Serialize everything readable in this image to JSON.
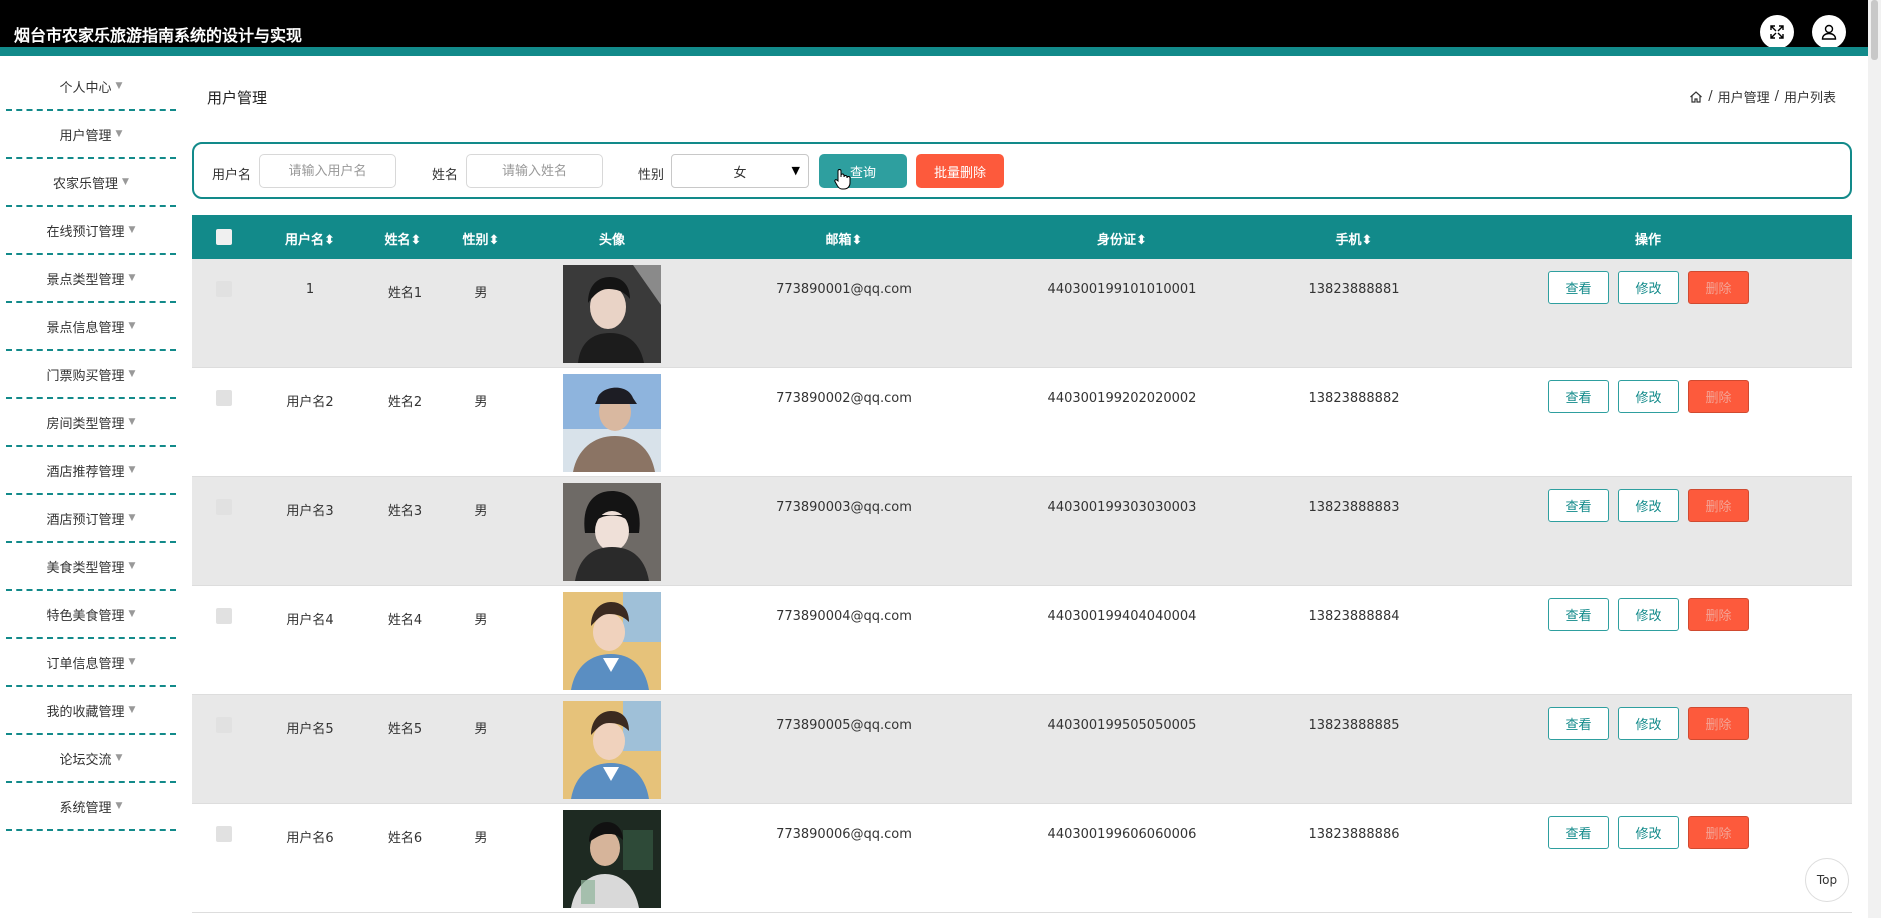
{
  "app": {
    "title": "烟台市农家乐旅游指南系统的设计与实现"
  },
  "sidebar": {
    "items": [
      {
        "label": "个人中心"
      },
      {
        "label": "用户管理"
      },
      {
        "label": "农家乐管理"
      },
      {
        "label": "在线预订管理"
      },
      {
        "label": "景点类型管理"
      },
      {
        "label": "景点信息管理"
      },
      {
        "label": "门票购买管理"
      },
      {
        "label": "房间类型管理"
      },
      {
        "label": "酒店推荐管理"
      },
      {
        "label": "酒店预订管理"
      },
      {
        "label": "美食类型管理"
      },
      {
        "label": "特色美食管理"
      },
      {
        "label": "订单信息管理"
      },
      {
        "label": "我的收藏管理"
      },
      {
        "label": "论坛交流"
      },
      {
        "label": "系统管理"
      }
    ]
  },
  "page": {
    "title": "用户管理"
  },
  "breadcrumb": {
    "sep": "/",
    "level1": "用户管理",
    "level2": "用户列表"
  },
  "search": {
    "username_label": "用户名",
    "username_placeholder": "请输入用户名",
    "name_label": "姓名",
    "name_placeholder": "请输入姓名",
    "gender_label": "性别",
    "gender_value": "女",
    "query_label": "查询",
    "batch_delete_label": "批量删除"
  },
  "table": {
    "headers": {
      "username": "用户名",
      "name": "姓名",
      "gender": "性别",
      "avatar": "头像",
      "email": "邮箱",
      "idcard": "身份证",
      "phone": "手机",
      "actions": "操作",
      "sort": "⬍"
    },
    "actions": {
      "view": "查看",
      "edit": "修改",
      "delete": "删除"
    },
    "rows": [
      {
        "username": "1",
        "name": "姓名1",
        "gender": "男",
        "email": "773890001@qq.com",
        "idcard": "440300199101010001",
        "phone": "13823888881"
      },
      {
        "username": "用户名2",
        "name": "姓名2",
        "gender": "男",
        "email": "773890002@qq.com",
        "idcard": "440300199202020002",
        "phone": "13823888882"
      },
      {
        "username": "用户名3",
        "name": "姓名3",
        "gender": "男",
        "email": "773890003@qq.com",
        "idcard": "440300199303030003",
        "phone": "13823888883"
      },
      {
        "username": "用户名4",
        "name": "姓名4",
        "gender": "男",
        "email": "773890004@qq.com",
        "idcard": "440300199404040004",
        "phone": "13823888884"
      },
      {
        "username": "用户名5",
        "name": "姓名5",
        "gender": "男",
        "email": "773890005@qq.com",
        "idcard": "440300199505050005",
        "phone": "13823888885"
      },
      {
        "username": "用户名6",
        "name": "姓名6",
        "gender": "男",
        "email": "773890006@qq.com",
        "idcard": "440300199606060006",
        "phone": "13823888886"
      }
    ]
  },
  "misc": {
    "top_label": "Top"
  },
  "colors": {
    "brand": "#128a8a",
    "danger": "#fd5a3c",
    "query": "#2e9f9f"
  },
  "icons": {
    "fullscreen": "fullscreen-icon",
    "user": "user-icon",
    "home": "home-icon",
    "sort": "sort-icon",
    "cursor": "hand-cursor-icon"
  }
}
